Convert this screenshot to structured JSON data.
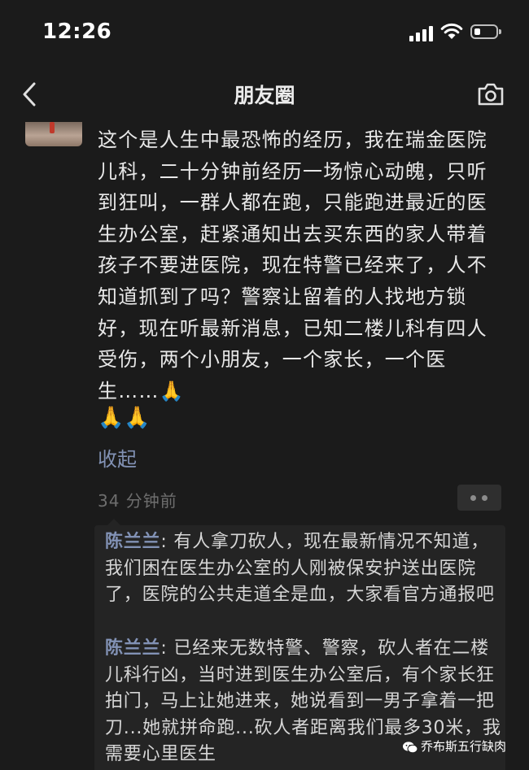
{
  "status_bar": {
    "time": "12:26"
  },
  "nav": {
    "title": "朋友圈",
    "back_icon": "chevron-left-icon",
    "camera_icon": "camera-icon"
  },
  "post": {
    "text": "这个是人生中最恐怖的经历，我在瑞金医院儿科，二十分钟前经历一场惊心动魄，只听到狂叫，一群人都在跑，只能跑进最近的医生办公室，赶紧通知出去买东西的家人带着孩子不要进医院，现在特警已经来了，人不知道抓到了吗？警察让留着的人找地方锁好，现在听最新消息，已知二楼儿科有四人受伤，两个小朋友，一个家长，一个医生……🙏",
    "emoji_line": "🙏🙏",
    "collapse_label": "收起",
    "time_ago": "34 分钟前"
  },
  "comments": [
    {
      "author": "陈兰兰",
      "separator": ": ",
      "text": "有人拿刀砍人，现在最新情况不知道，我们困在医生办公室的人刚被保安护送出医院了，医院的公共走道全是血，大家看官方通报吧"
    },
    {
      "author": "陈兰兰",
      "separator": ": ",
      "text": "已经来无数特警、警察，砍人者在二楼儿科行凶，当时进到医生办公室后，有个家长狂拍门，马上让她进来，她说看到一男子拿着一把刀...她就拼命跑...砍人者距离我们最多30米，我需要心里医生"
    }
  ],
  "watermark": {
    "text": "乔布斯五行缺肉"
  },
  "colors": {
    "background": "#1b1b1b",
    "link": "#8292b5",
    "comment_bg": "#242424",
    "muted": "#6e6e6e"
  }
}
